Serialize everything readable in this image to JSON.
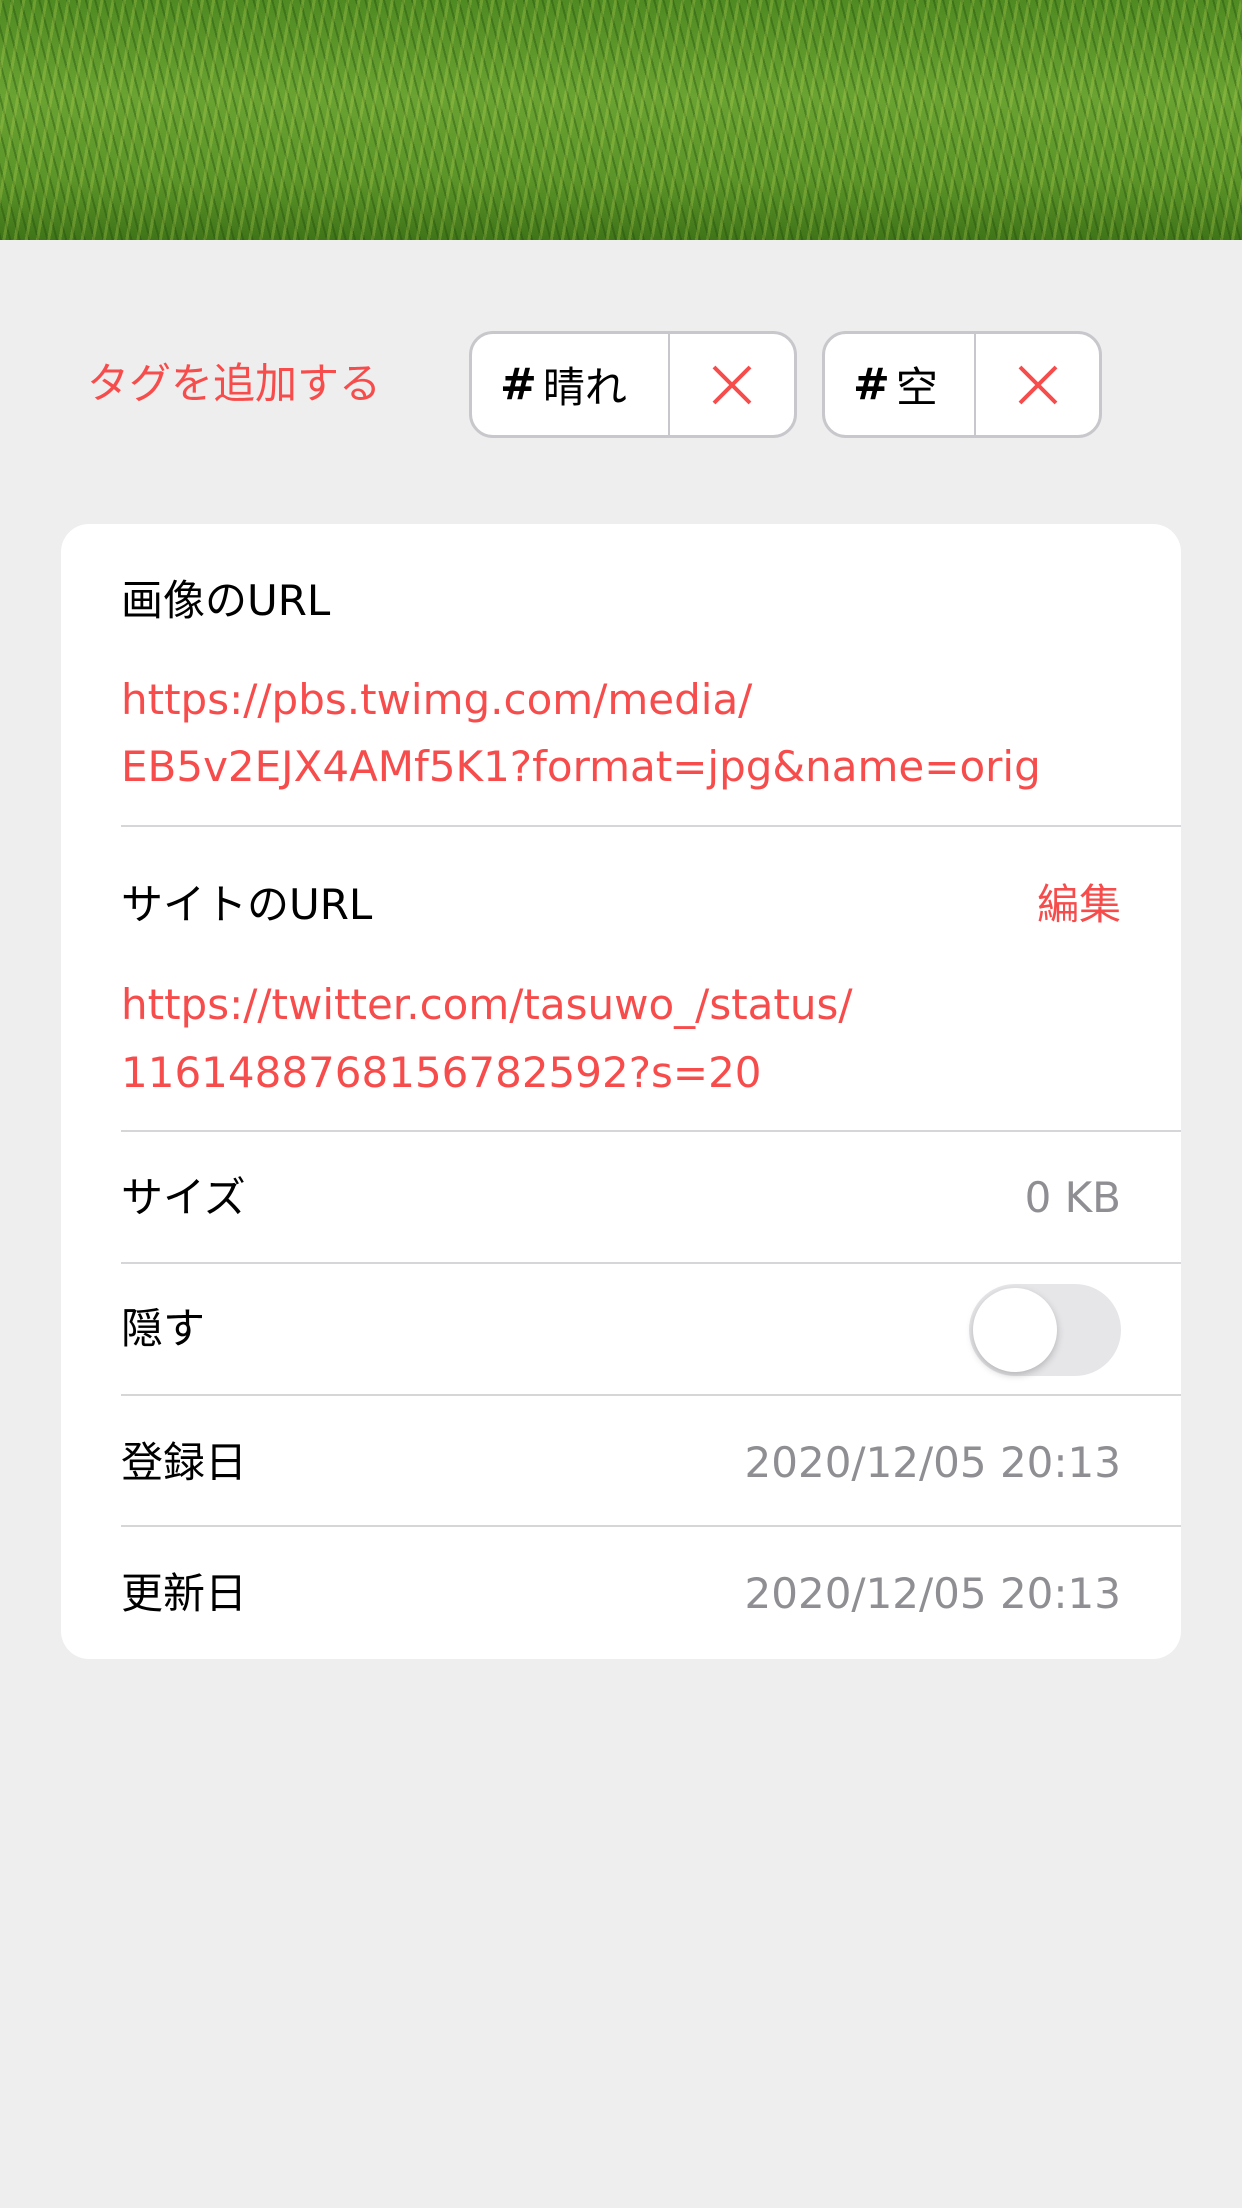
{
  "tags": {
    "add_label": "タグを追加する",
    "items": [
      {
        "hash": "#",
        "label": "晴れ"
      },
      {
        "hash": "#",
        "label": "空"
      }
    ]
  },
  "details": {
    "image_url": {
      "label": "画像のURL",
      "line1": "https://pbs.twimg.com/media/",
      "line2": "EB5v2EJX4AMf5K1?format=jpg&name=orig"
    },
    "site_url": {
      "label": "サイトのURL",
      "edit": "編集",
      "line1": "https://twitter.com/tasuwo_/status/",
      "line2": "1161488768156782592?s=20"
    },
    "size": {
      "label": "サイズ",
      "value": "0 KB"
    },
    "hide": {
      "label": "隠す",
      "on": false
    },
    "created": {
      "label": "登録日",
      "value": "2020/12/05 20:13"
    },
    "updated": {
      "label": "更新日",
      "value": "2020/12/05 20:13"
    }
  },
  "colors": {
    "accent": "#f74c4c",
    "background": "#eeeeee"
  }
}
